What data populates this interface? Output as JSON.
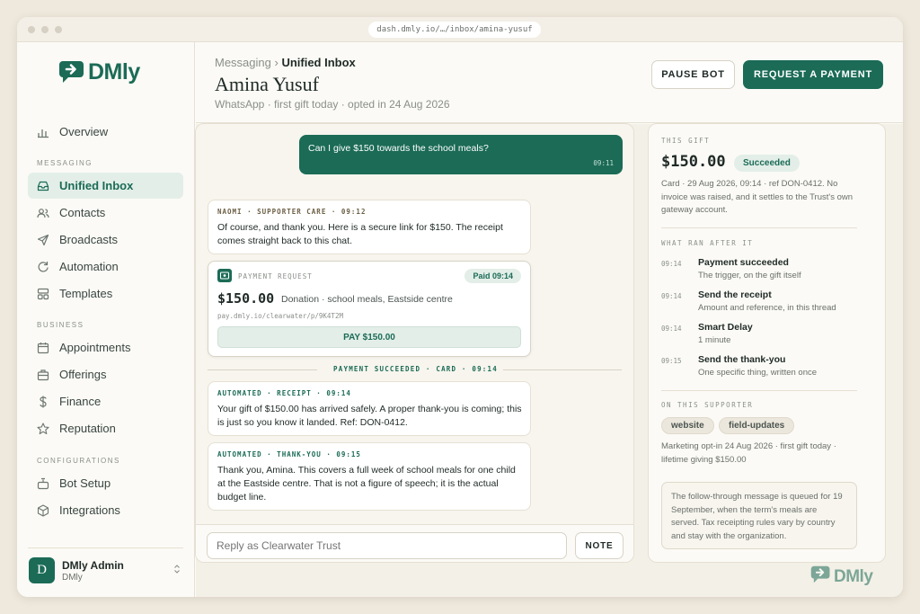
{
  "browser": {
    "url": "dash.dmly.io/…/inbox/amina-yusuf"
  },
  "brand": {
    "name": "DMly",
    "accent": "#1b6b56"
  },
  "sidebar": {
    "overview": "Overview",
    "section_messaging": "MESSAGING",
    "messaging_items": [
      {
        "label": "Unified Inbox",
        "icon": "inbox-icon",
        "active": true
      },
      {
        "label": "Contacts",
        "icon": "contacts-icon"
      },
      {
        "label": "Broadcasts",
        "icon": "send-icon"
      },
      {
        "label": "Automation",
        "icon": "refresh-icon"
      },
      {
        "label": "Templates",
        "icon": "templates-icon"
      }
    ],
    "section_business": "BUSINESS",
    "business_items": [
      {
        "label": "Appointments",
        "icon": "calendar-icon"
      },
      {
        "label": "Offerings",
        "icon": "briefcase-icon"
      },
      {
        "label": "Finance",
        "icon": "dollar-icon"
      },
      {
        "label": "Reputation",
        "icon": "star-icon"
      }
    ],
    "section_config": "CONFIGURATIONS",
    "config_items": [
      {
        "label": "Bot Setup",
        "icon": "bot-icon"
      },
      {
        "label": "Integrations",
        "icon": "cube-icon"
      }
    ],
    "user": {
      "initial": "D",
      "name": "DMly Admin",
      "role": "DMly"
    }
  },
  "header": {
    "crumb_parent": "Messaging ›",
    "crumb_current": "Unified Inbox",
    "title": "Amina Yusuf",
    "subtitle": "WhatsApp · first gift today · opted in 24 Aug 2026",
    "pause_label": "PAUSE BOT",
    "request_label": "REQUEST A PAYMENT"
  },
  "chat": {
    "outgoing": {
      "text": "Can I give $150 towards the school meals?",
      "time": "09:11"
    },
    "reply1": {
      "label": "NAOMI · SUPPORTER CARE · 09:12",
      "text": "Of course, and thank you. Here is a secure link for $150. The receipt comes straight back to this chat."
    },
    "payment": {
      "label": "PAYMENT REQUEST",
      "badge": "Paid 09:14",
      "amount": "$150.00",
      "desc": "Donation · school meals, Eastside centre",
      "url": "pay.dmly.io/clearwater/p/9K4T2M",
      "button": "PAY $150.00"
    },
    "divider": "PAYMENT SUCCEEDED · CARD · 09:14",
    "receipt": {
      "label": "AUTOMATED · RECEIPT · 09:14",
      "text": "Your gift of $150.00 has arrived safely. A proper thank-you is coming; this is just so you know it landed. Ref: DON-0412."
    },
    "thanks": {
      "label": "AUTOMATED · THANK-YOU · 09:15",
      "text": "Thank you, Amina. This covers a full week of school meals for one child at the Eastside centre. That is not a figure of speech; it is the actual budget line."
    },
    "composer_placeholder": "Reply as Clearwater Trust",
    "note_label": "NOTE"
  },
  "panel": {
    "gift_label": "THIS GIFT",
    "amount": "$150.00",
    "status": "Succeeded",
    "gift_detail": "Card · 29 Aug 2026, 09:14 · ref DON-0412. No invoice was raised, and it settles to the Trust's own gateway account.",
    "ran_label": "WHAT RAN AFTER IT",
    "steps": [
      {
        "time": "09:14",
        "title": "Payment succeeded",
        "sub": "The trigger, on the gift itself"
      },
      {
        "time": "09:14",
        "title": "Send the receipt",
        "sub": "Amount and reference, in this thread"
      },
      {
        "time": "09:14",
        "title": "Smart Delay",
        "sub": "1 minute"
      },
      {
        "time": "09:15",
        "title": "Send the thank-you",
        "sub": "One specific thing, written once"
      }
    ],
    "supporter_label": "ON THIS SUPPORTER",
    "tags": [
      "website",
      "field-updates"
    ],
    "supporter_detail": "Marketing opt-in 24 Aug 2026 · first gift today · lifetime giving $150.00",
    "note": "The follow-through message is queued for 19 September, when the term's meals are served. Tax receipting rules vary by country and stay with the organization."
  }
}
